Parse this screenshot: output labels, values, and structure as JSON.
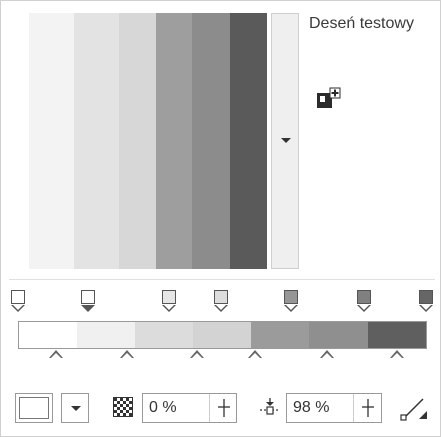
{
  "panel": {
    "title": "Deseń testowy"
  },
  "preview": {
    "strips": [
      "#ffffff",
      "#f3f3f3",
      "#e3e3e3",
      "#d7d7d7",
      "#9e9e9e",
      "#8c8c8c",
      "#707070",
      "#5a5a5a"
    ]
  },
  "stops": [
    {
      "color": "#ffffff",
      "selected": false
    },
    {
      "color": "#ffffff",
      "selected": true
    },
    {
      "color": "#e6e6e6",
      "selected": false
    },
    {
      "color": "#dddddd",
      "selected": false
    },
    {
      "color": "#969696",
      "selected": false
    },
    {
      "color": "#808080",
      "selected": false
    },
    {
      "color": "#666666",
      "selected": false
    }
  ],
  "gradient_bar": {
    "segments": [
      "#ffffff",
      "#f0f0f0",
      "#dcdcdc",
      "#d3d3d3",
      "#9b9b9b",
      "#8f8f8f",
      "#5f5f5f"
    ]
  },
  "controls": {
    "transparency_value": "0 %",
    "position_value": "98 %"
  },
  "icons": {
    "add": "add-swatch-icon",
    "transparency": "checkerboard-icon",
    "position": "vertical-position-icon",
    "resize": "resize-diagonal-icon"
  }
}
